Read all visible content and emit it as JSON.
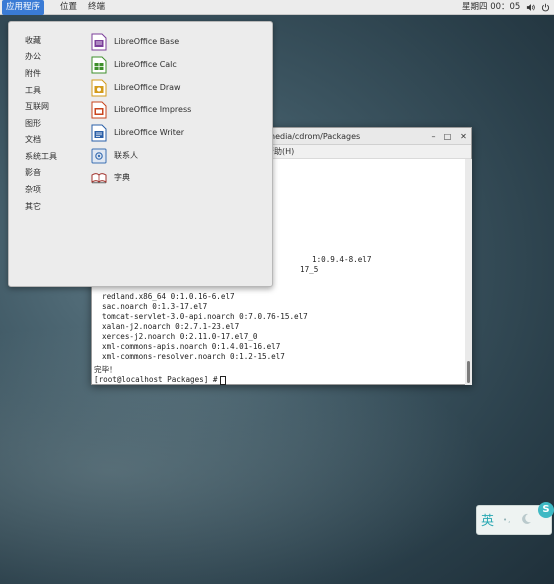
{
  "topbar": {
    "applications_label": "应用程序",
    "places_label": "位置",
    "terminal_label": "终端",
    "clock": "星期四 00：05"
  },
  "terminal": {
    "title": "nedia/cdrom/Packages",
    "menu_help": "帮助(H)",
    "lines": [
      "1:0.9.4-8.el7",
      "17_5",
      "redland.x86_64 0:1.0.16-6.el7",
      "sac.noarch 0:1.3-17.el7",
      "tomcat-servlet-3.0-api.noarch 0:7.0.76-15.el7",
      "xalan-j2.noarch 0:2.7.1-23.el7",
      "xerces-j2.noarch 0:2.11.0-17.el7_0",
      "xml-commons-apis.noarch 0:1.4.01-16.el7",
      "xml-commons-resolver.noarch 0:1.2-15.el7"
    ],
    "complete_text": "完毕！",
    "prompt": "root@localhost Packages",
    "prompt_symbol": "#"
  },
  "apps_menu": {
    "categories": [
      "收藏",
      "办公",
      "附件",
      "工具",
      "互联网",
      "图形",
      "文档",
      "系统工具",
      "影音",
      "杂项",
      "其它"
    ],
    "apps": [
      {
        "label": "LibreOffice Base",
        "icon": "libreoffice-base-icon",
        "color": "#7b3e9a"
      },
      {
        "label": "LibreOffice Calc",
        "icon": "libreoffice-calc-icon",
        "color": "#3e8f2b"
      },
      {
        "label": "LibreOffice Draw",
        "icon": "libreoffice-draw-icon",
        "color": "#d39b1b"
      },
      {
        "label": "LibreOffice Impress",
        "icon": "libreoffice-impress-icon",
        "color": "#c9441d"
      },
      {
        "label": "LibreOffice Writer",
        "icon": "libreoffice-writer-icon",
        "color": "#2a5fa8"
      },
      {
        "label": "联系人",
        "icon": "contacts-icon",
        "color": "#3b6fb2"
      },
      {
        "label": "字典",
        "icon": "dictionary-icon",
        "color": "#a0302a"
      }
    ]
  },
  "ime": {
    "mode_char": "英",
    "logo_char": "S"
  },
  "colors": {
    "accent": "#3a7bd5",
    "ime_accent": "#3fb9c4"
  }
}
